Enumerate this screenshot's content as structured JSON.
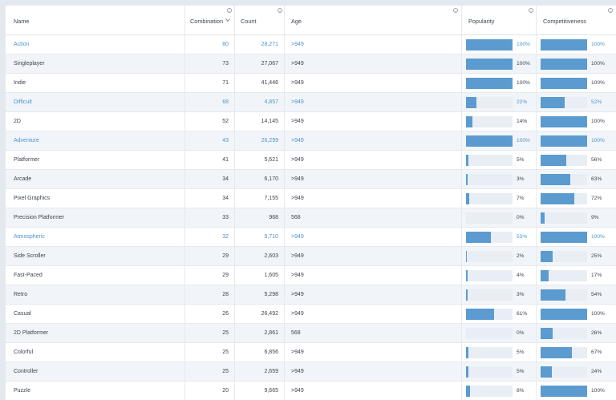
{
  "columns": {
    "name": "Name",
    "combination": "Combination",
    "count": "Count",
    "age": "Age",
    "popularity": "Popularity",
    "competitiveness": "Competitiveness"
  },
  "rows": [
    {
      "name": "Action",
      "combination": "80",
      "count": "28,271",
      "age": ">949",
      "popularity": "100%",
      "popularity_value": 1.0,
      "competitiveness": "100%",
      "competitiveness_value": 1.0,
      "highlighted": true
    },
    {
      "name": "Singleplayer",
      "combination": "73",
      "count": "27,067",
      "age": ">949",
      "popularity": "100%",
      "popularity_value": 1.0,
      "competitiveness": "100%",
      "competitiveness_value": 1.0,
      "highlighted": false
    },
    {
      "name": "Indie",
      "combination": "71",
      "count": "41,446",
      "age": ">949",
      "popularity": "100%",
      "popularity_value": 1.0,
      "competitiveness": "100%",
      "competitiveness_value": 1.0,
      "highlighted": false
    },
    {
      "name": "Difficult",
      "combination": "68",
      "count": "4,857",
      "age": ">949",
      "popularity": "22%",
      "popularity_value": 0.22,
      "competitiveness": "52%",
      "competitiveness_value": 0.52,
      "highlighted": true
    },
    {
      "name": "2D",
      "combination": "52",
      "count": "14,145",
      "age": ">949",
      "popularity": "14%",
      "popularity_value": 0.14,
      "competitiveness": "100%",
      "competitiveness_value": 1.0,
      "highlighted": false
    },
    {
      "name": "Adventure",
      "combination": "43",
      "count": "26,299",
      "age": ">949",
      "popularity": "100%",
      "popularity_value": 1.0,
      "competitiveness": "100%",
      "competitiveness_value": 1.0,
      "highlighted": true
    },
    {
      "name": "Platformer",
      "combination": "41",
      "count": "5,621",
      "age": ">949",
      "popularity": "5%",
      "popularity_value": 0.05,
      "competitiveness": "56%",
      "competitiveness_value": 0.56,
      "highlighted": false
    },
    {
      "name": "Arcade",
      "combination": "34",
      "count": "6,170",
      "age": ">949",
      "popularity": "3%",
      "popularity_value": 0.03,
      "competitiveness": "63%",
      "competitiveness_value": 0.63,
      "highlighted": false
    },
    {
      "name": "Pixel Graphics",
      "combination": "34",
      "count": "7,155",
      "age": ">949",
      "popularity": "7%",
      "popularity_value": 0.07,
      "competitiveness": "72%",
      "competitiveness_value": 0.72,
      "highlighted": false
    },
    {
      "name": "Precision Platformer",
      "combination": "33",
      "count": "968",
      "age": "568",
      "popularity": "0%",
      "popularity_value": 0.0,
      "competitiveness": "9%",
      "competitiveness_value": 0.09,
      "highlighted": false
    },
    {
      "name": "Atmospheric",
      "combination": "32",
      "count": "9,710",
      "age": ">949",
      "popularity": "53%",
      "popularity_value": 0.53,
      "competitiveness": "100%",
      "competitiveness_value": 1.0,
      "highlighted": true
    },
    {
      "name": "Side Scroller",
      "combination": "29",
      "count": "2,603",
      "age": ">949",
      "popularity": "2%",
      "popularity_value": 0.02,
      "competitiveness": "25%",
      "competitiveness_value": 0.25,
      "highlighted": false
    },
    {
      "name": "Fast-Paced",
      "combination": "29",
      "count": "1,605",
      "age": ">949",
      "popularity": "4%",
      "popularity_value": 0.04,
      "competitiveness": "17%",
      "competitiveness_value": 0.17,
      "highlighted": false
    },
    {
      "name": "Retro",
      "combination": "28",
      "count": "5,298",
      "age": ">949",
      "popularity": "3%",
      "popularity_value": 0.03,
      "competitiveness": "54%",
      "competitiveness_value": 0.54,
      "highlighted": false
    },
    {
      "name": "Casual",
      "combination": "26",
      "count": "26,492",
      "age": ">949",
      "popularity": "61%",
      "popularity_value": 0.61,
      "competitiveness": "100%",
      "competitiveness_value": 1.0,
      "highlighted": false
    },
    {
      "name": "2D Platformer",
      "combination": "25",
      "count": "2,861",
      "age": "568",
      "popularity": "0%",
      "popularity_value": 0.0,
      "competitiveness": "26%",
      "competitiveness_value": 0.26,
      "highlighted": false
    },
    {
      "name": "Colorful",
      "combination": "25",
      "count": "6,856",
      "age": ">949",
      "popularity": "5%",
      "popularity_value": 0.05,
      "competitiveness": "67%",
      "competitiveness_value": 0.67,
      "highlighted": false
    },
    {
      "name": "Controller",
      "combination": "25",
      "count": "2,659",
      "age": ">949",
      "popularity": "5%",
      "popularity_value": 0.05,
      "competitiveness": "24%",
      "competitiveness_value": 0.24,
      "highlighted": false
    },
    {
      "name": "Puzzle",
      "combination": "20",
      "count": "9,665",
      "age": ">949",
      "popularity": "8%",
      "popularity_value": 0.08,
      "competitiveness": "100%",
      "competitiveness_value": 1.0,
      "highlighted": false
    }
  ],
  "icons": {
    "info": "info-circle-icon",
    "sort": "chevron-down-icon"
  },
  "colors": {
    "link": "#4f93c9",
    "bar_fill": "#5b9bd0",
    "bar_track": "#e8eef4",
    "row_alt": "#f1f5f9"
  }
}
